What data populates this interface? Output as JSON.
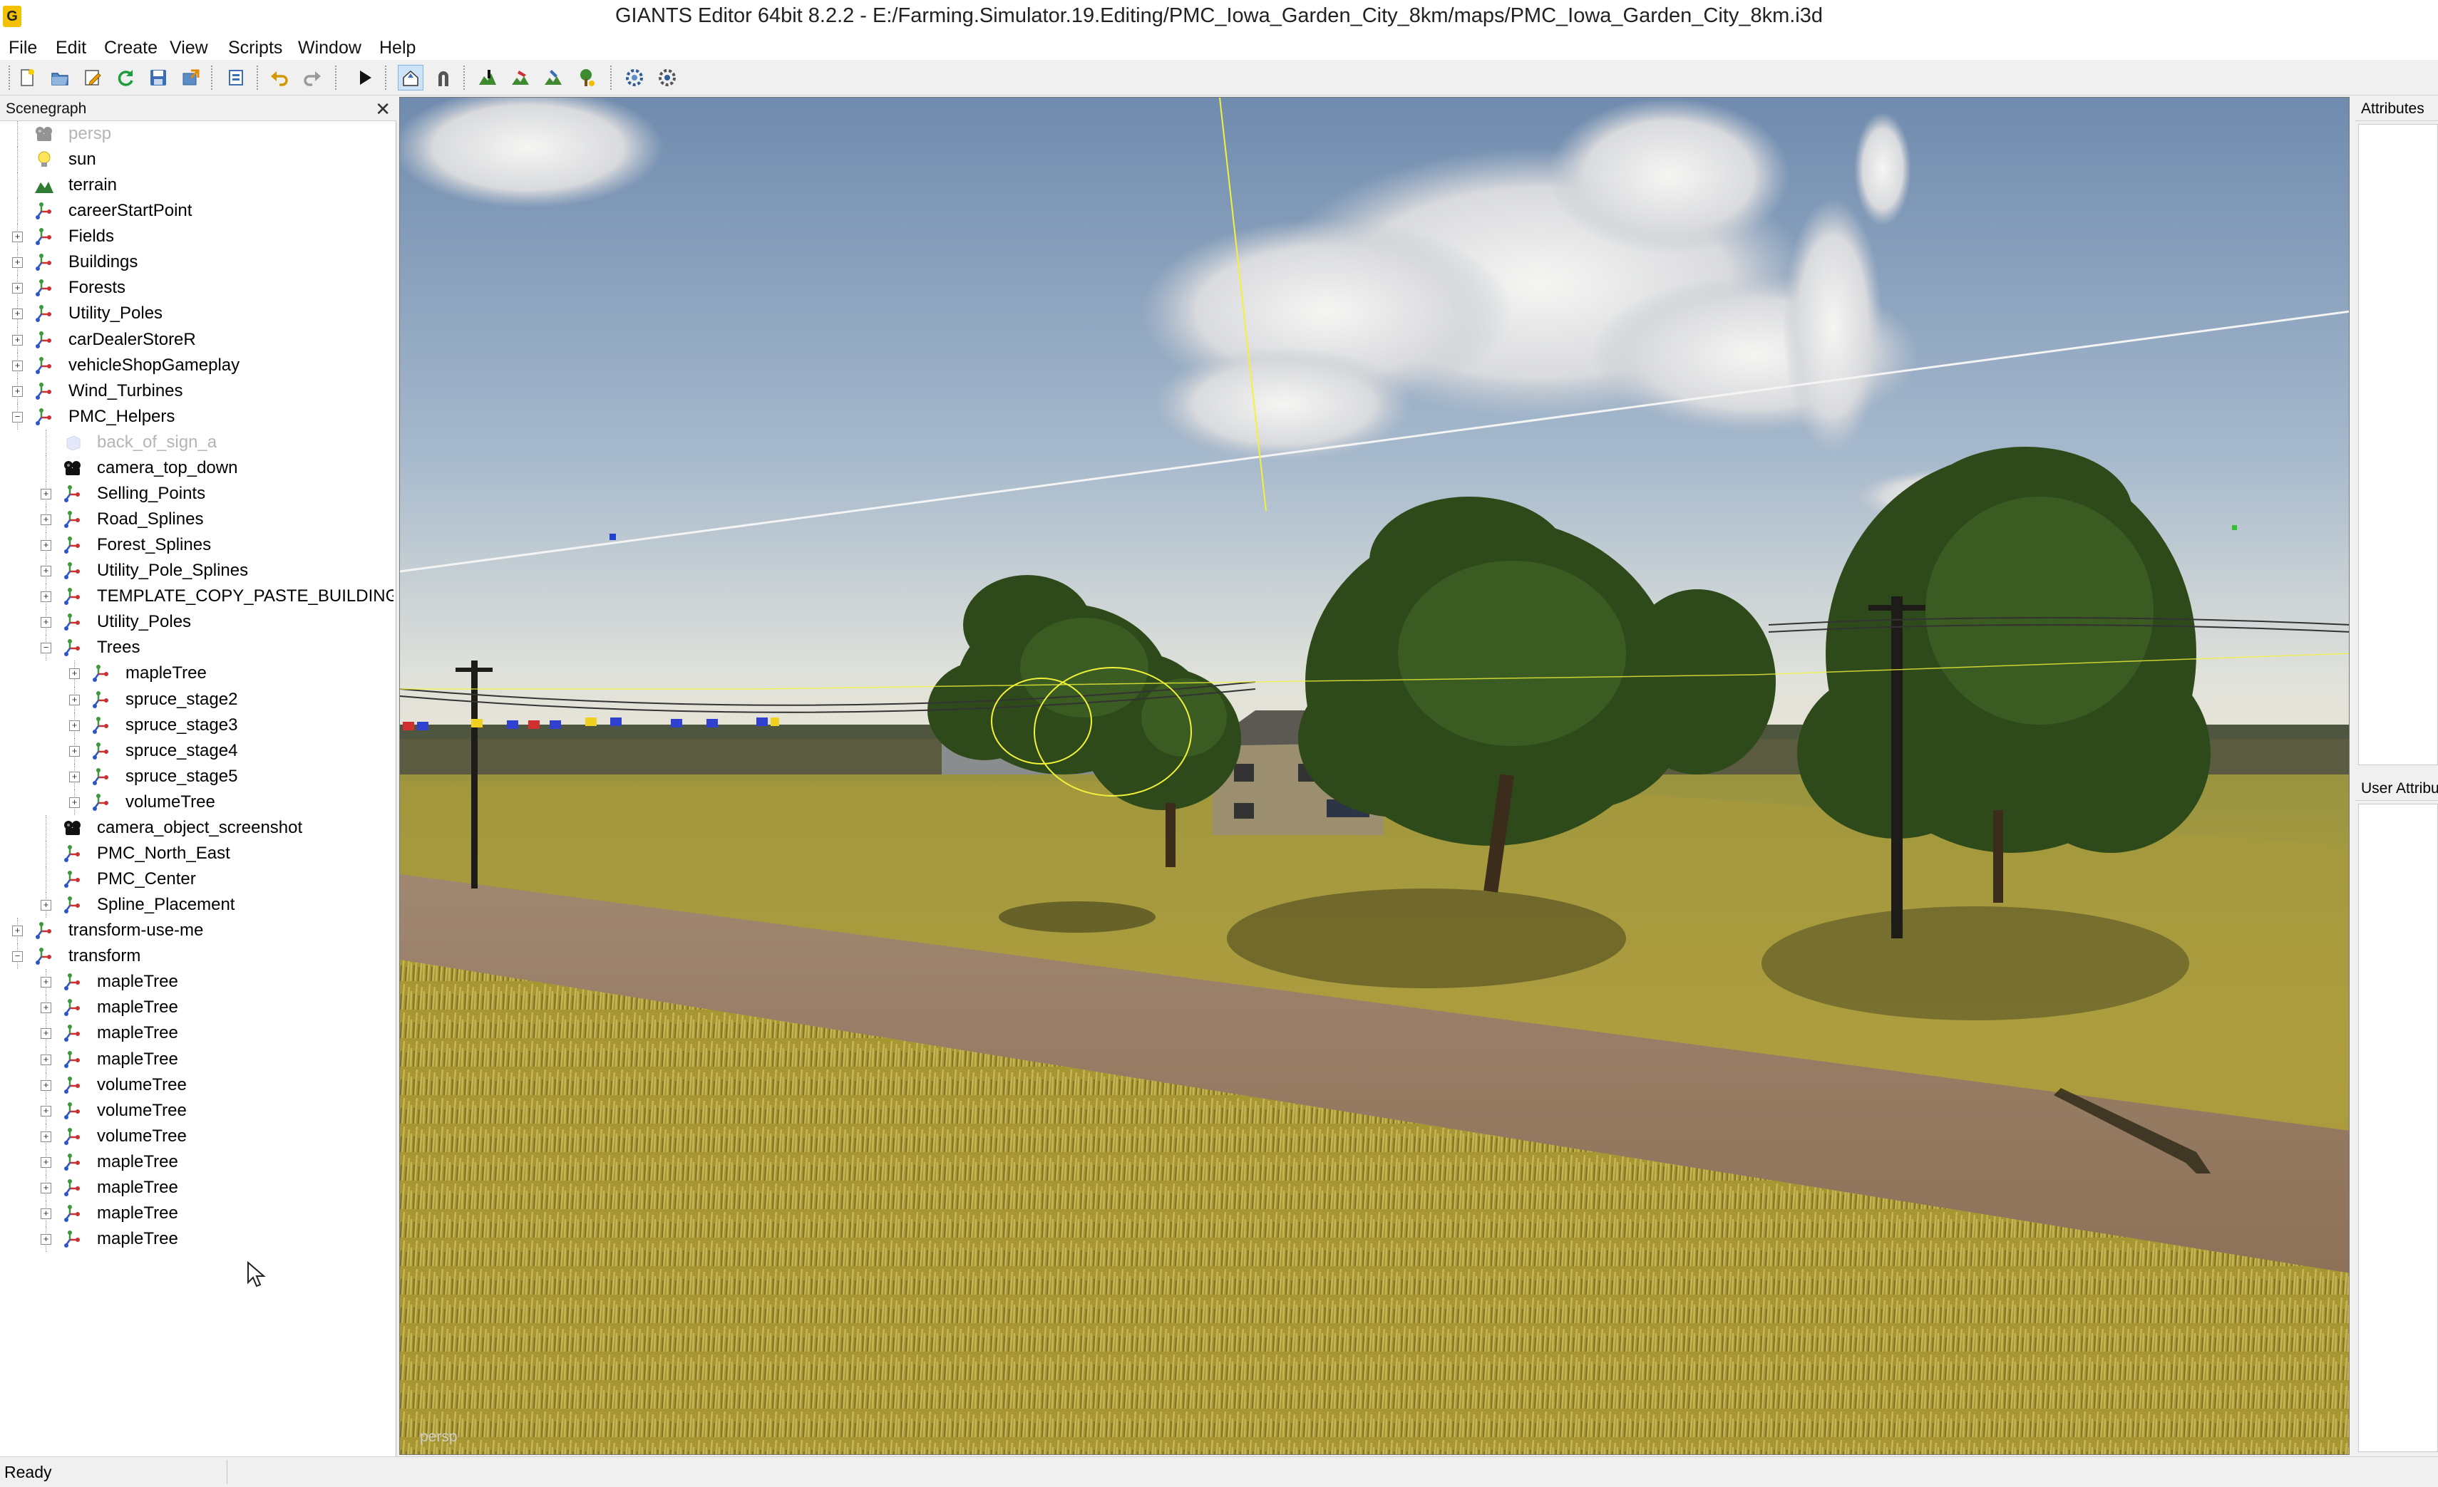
{
  "window": {
    "title": "GIANTS Editor 64bit 8.2.2 - E:/Farming.Simulator.19.Editing/PMC_Iowa_Garden_City_8km/maps/PMC_Iowa_Garden_City_8km.i3d",
    "app_icon": "giants-editor-icon"
  },
  "menu": [
    "File",
    "Edit",
    "Create",
    "View",
    "Scripts",
    "Window",
    "Help"
  ],
  "toolbar": {
    "buttons": [
      "new-file-icon",
      "open-file-icon",
      "edit-icon",
      "refresh-icon",
      "save-icon",
      "export-icon",
      "import-icon",
      "undo-icon",
      "redo-icon",
      "play-icon",
      "select-mode-icon",
      "snap-icon",
      "terrain-sculpt-icon",
      "paint-icon",
      "foliage-paint-icon",
      "place-object-icon",
      "settings-icon",
      "render-settings-icon"
    ]
  },
  "scenegraph": {
    "title": "Scenegraph",
    "close_label": "✕",
    "nodes": [
      {
        "label": "persp",
        "depth": 0,
        "icon": "camera",
        "expander": "",
        "dim": true
      },
      {
        "label": "sun",
        "depth": 0,
        "icon": "light",
        "expander": "",
        "dim": false
      },
      {
        "label": "terrain",
        "depth": 0,
        "icon": "terrain",
        "expander": "",
        "dim": false
      },
      {
        "label": "careerStartPoint",
        "depth": 0,
        "icon": "transform",
        "expander": "",
        "dim": false
      },
      {
        "label": "Fields",
        "depth": 0,
        "icon": "transform",
        "expander": "+",
        "dim": false
      },
      {
        "label": "Buildings",
        "depth": 0,
        "icon": "transform",
        "expander": "+",
        "dim": false
      },
      {
        "label": "Forests",
        "depth": 0,
        "icon": "transform",
        "expander": "+",
        "dim": false
      },
      {
        "label": "Utility_Poles",
        "depth": 0,
        "icon": "transform",
        "expander": "+",
        "dim": false
      },
      {
        "label": "carDealerStoreR",
        "depth": 0,
        "icon": "transform",
        "expander": "+",
        "dim": false
      },
      {
        "label": "vehicleShopGameplay",
        "depth": 0,
        "icon": "transform",
        "expander": "+",
        "dim": false
      },
      {
        "label": "Wind_Turbines",
        "depth": 0,
        "icon": "transform",
        "expander": "+",
        "dim": false
      },
      {
        "label": "PMC_Helpers",
        "depth": 0,
        "icon": "transform",
        "expander": "−",
        "dim": false
      },
      {
        "label": "back_of_sign_a",
        "depth": 1,
        "icon": "shape",
        "expander": "",
        "dim": true
      },
      {
        "label": "camera_top_down",
        "depth": 1,
        "icon": "camera",
        "expander": "",
        "dim": false
      },
      {
        "label": "Selling_Points",
        "depth": 1,
        "icon": "transform",
        "expander": "+",
        "dim": false
      },
      {
        "label": "Road_Splines",
        "depth": 1,
        "icon": "transform",
        "expander": "+",
        "dim": false
      },
      {
        "label": "Forest_Splines",
        "depth": 1,
        "icon": "transform",
        "expander": "+",
        "dim": false
      },
      {
        "label": "Utility_Pole_Splines",
        "depth": 1,
        "icon": "transform",
        "expander": "+",
        "dim": false
      },
      {
        "label": "TEMPLATE_COPY_PASTE_BUILDINGS",
        "depth": 1,
        "icon": "transform",
        "expander": "+",
        "dim": false
      },
      {
        "label": "Utility_Poles",
        "depth": 1,
        "icon": "transform",
        "expander": "+",
        "dim": false
      },
      {
        "label": "Trees",
        "depth": 1,
        "icon": "transform",
        "expander": "−",
        "dim": false
      },
      {
        "label": "mapleTree",
        "depth": 2,
        "icon": "transform",
        "expander": "+",
        "dim": false
      },
      {
        "label": "spruce_stage2",
        "depth": 2,
        "icon": "transform",
        "expander": "+",
        "dim": false
      },
      {
        "label": "spruce_stage3",
        "depth": 2,
        "icon": "transform",
        "expander": "+",
        "dim": false
      },
      {
        "label": "spruce_stage4",
        "depth": 2,
        "icon": "transform",
        "expander": "+",
        "dim": false
      },
      {
        "label": "spruce_stage5",
        "depth": 2,
        "icon": "transform",
        "expander": "+",
        "dim": false
      },
      {
        "label": "volumeTree",
        "depth": 2,
        "icon": "transform",
        "expander": "+",
        "dim": false
      },
      {
        "label": "camera_object_screenshot",
        "depth": 1,
        "icon": "camera",
        "expander": "",
        "dim": false
      },
      {
        "label": "PMC_North_East",
        "depth": 1,
        "icon": "transform",
        "expander": "",
        "dim": false
      },
      {
        "label": "PMC_Center",
        "depth": 1,
        "icon": "transform",
        "expander": "",
        "dim": false
      },
      {
        "label": "Spline_Placement",
        "depth": 1,
        "icon": "transform",
        "expander": "+",
        "dim": false
      },
      {
        "label": "transform-use-me",
        "depth": 0,
        "icon": "transform",
        "expander": "+",
        "dim": false
      },
      {
        "label": "transform",
        "depth": 0,
        "icon": "transform",
        "expander": "−",
        "dim": false
      },
      {
        "label": "mapleTree",
        "depth": 1,
        "icon": "transform",
        "expander": "+",
        "dim": false
      },
      {
        "label": "mapleTree",
        "depth": 1,
        "icon": "transform",
        "expander": "+",
        "dim": false
      },
      {
        "label": "mapleTree",
        "depth": 1,
        "icon": "transform",
        "expander": "+",
        "dim": false
      },
      {
        "label": "mapleTree",
        "depth": 1,
        "icon": "transform",
        "expander": "+",
        "dim": false
      },
      {
        "label": "volumeTree",
        "depth": 1,
        "icon": "transform",
        "expander": "+",
        "dim": false
      },
      {
        "label": "volumeTree",
        "depth": 1,
        "icon": "transform",
        "expander": "+",
        "dim": false
      },
      {
        "label": "volumeTree",
        "depth": 1,
        "icon": "transform",
        "expander": "+",
        "dim": false
      },
      {
        "label": "mapleTree",
        "depth": 1,
        "icon": "transform",
        "expander": "+",
        "dim": false
      },
      {
        "label": "mapleTree",
        "depth": 1,
        "icon": "transform",
        "expander": "+",
        "dim": false
      },
      {
        "label": "mapleTree",
        "depth": 1,
        "icon": "transform",
        "expander": "+",
        "dim": false
      },
      {
        "label": "mapleTree",
        "depth": 1,
        "icon": "transform",
        "expander": "+",
        "dim": false
      }
    ]
  },
  "viewport": {
    "camera_label": "persp"
  },
  "attributes_panel": {
    "title": "Attributes"
  },
  "user_attributes_panel": {
    "title": "User Attributes"
  },
  "statusbar": {
    "text": "Ready"
  },
  "colors": {
    "selection_accent": "#cde3f7",
    "sky": "#8fa6be",
    "field": "#a89a3c",
    "road": "#9c8268",
    "gizmo_yellow": "#f2f23a"
  }
}
